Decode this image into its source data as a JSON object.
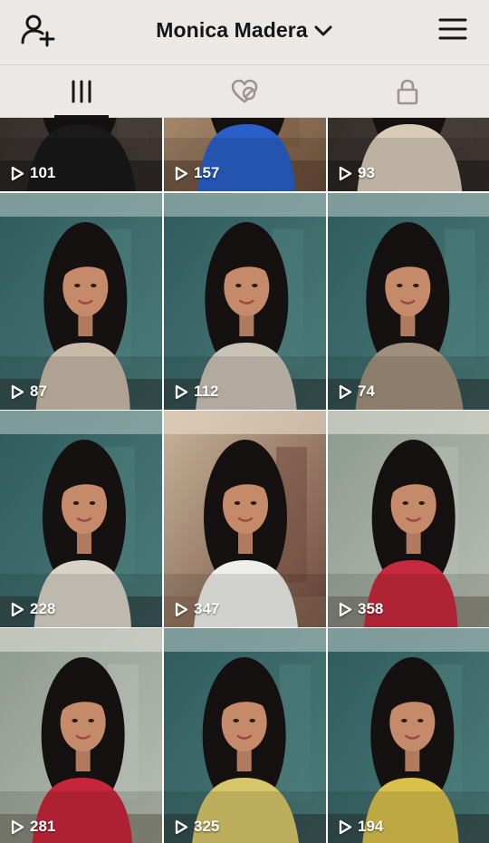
{
  "header": {
    "username": "Monica Madera",
    "icons": {
      "left": "add-user-icon",
      "title": "chevron-down-icon",
      "right": "hamburger-menu-icon"
    }
  },
  "tabs": [
    {
      "icon": "grid-icon",
      "selected": true
    },
    {
      "icon": "liked-hidden-icon",
      "selected": false
    },
    {
      "icon": "lock-icon",
      "selected": false
    }
  ],
  "videos": [
    {
      "views": "101",
      "scene": "dark"
    },
    {
      "views": "157",
      "scene": "blue-shirt"
    },
    {
      "views": "93",
      "scene": "dark"
    },
    {
      "views": "87",
      "scene": "teal-room"
    },
    {
      "views": "112",
      "scene": "teal-room"
    },
    {
      "views": "74",
      "scene": "teal-room"
    },
    {
      "views": "228",
      "scene": "teal-room"
    },
    {
      "views": "347",
      "scene": "beige-room"
    },
    {
      "views": "358",
      "scene": "green-room"
    },
    {
      "views": "281",
      "scene": "green-room"
    },
    {
      "views": "325",
      "scene": "teal-room"
    },
    {
      "views": "194",
      "scene": "teal-room"
    }
  ],
  "colors": {
    "header_bg": "#ece8e5",
    "text": "#161616",
    "tab_inactive": "#9a9592"
  }
}
